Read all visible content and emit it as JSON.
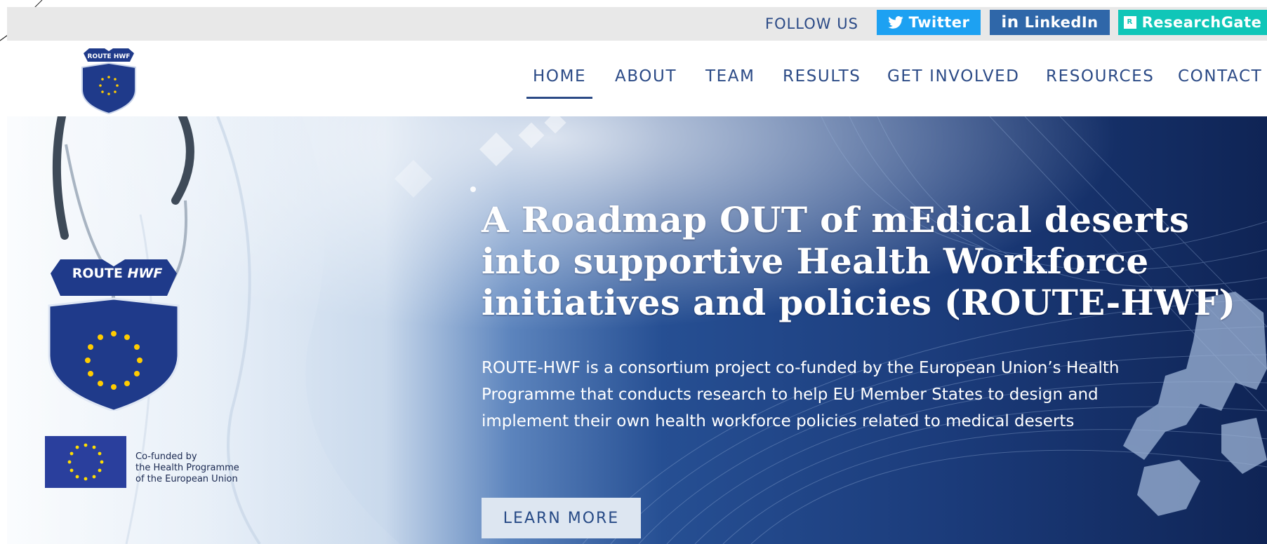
{
  "social": {
    "follow_label": "FOLLOW US",
    "buttons": [
      {
        "label": "Twitter",
        "icon": "twitter-bird-icon",
        "color": "#1da1f2"
      },
      {
        "label": "LinkedIn",
        "icon": "linkedin-in-icon",
        "color": "#2f67a9"
      },
      {
        "label": "ResearchGate",
        "icon": "researchgate-icon",
        "color": "#10c6b8"
      }
    ]
  },
  "header": {
    "logo_text": "ROUTE HWF",
    "nav": [
      {
        "label": "HOME",
        "active": true
      },
      {
        "label": "ABOUT",
        "active": false
      },
      {
        "label": "TEAM",
        "active": false
      },
      {
        "label": "RESULTS",
        "active": false
      },
      {
        "label": "GET INVOLVED",
        "active": false
      },
      {
        "label": "RESOURCES",
        "active": false
      },
      {
        "label": "CONTACT",
        "active": false
      }
    ]
  },
  "hero": {
    "title": "A Roadmap OUT of mEdical deserts into supportive Health Workforce initiatives and policies (ROUTE-HWF)",
    "description": "ROUTE-HWF is a consortium project co-funded by the European Union’s Health Programme that conducts research to help EU Member States to design and implement their own health workforce policies related to medical deserts",
    "cta_label": "LEARN MORE",
    "badge_text_route": "ROUTE",
    "badge_text_hwf": "HWF",
    "cofunded_lines": [
      "Co-funded by",
      "the Health Programme",
      "of the European Union"
    ]
  },
  "colors": {
    "brand_navy": "#2b4a86",
    "badge_blue": "#1f3a8a",
    "eu_star": "#ffcc00",
    "topbar_bg": "#e8e8e8"
  }
}
